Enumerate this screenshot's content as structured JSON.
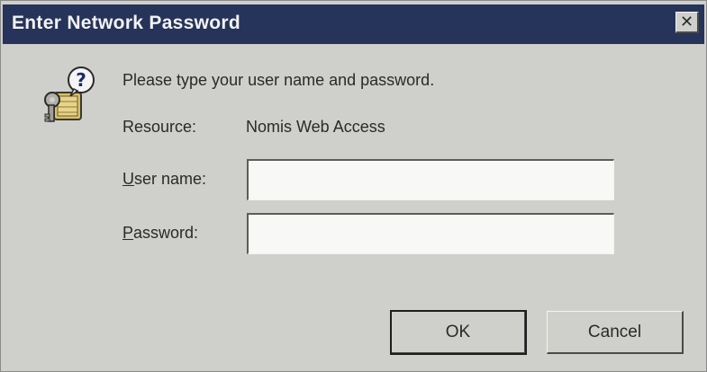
{
  "window": {
    "title": "Enter Network Password",
    "close_glyph": "✕"
  },
  "icon": {
    "name": "keys-icon"
  },
  "prompt": "Please type your user name and password.",
  "resource": {
    "label": "Resource:",
    "value": "Nomis Web Access"
  },
  "user_name": {
    "label_accel": "U",
    "label_rest": "ser name:",
    "value": "",
    "placeholder": ""
  },
  "password": {
    "label_accel": "P",
    "label_rest": "assword:",
    "value": "",
    "placeholder": ""
  },
  "buttons": {
    "ok": "OK",
    "cancel": "Cancel"
  },
  "colors": {
    "titlebar": "#26335a",
    "dialog_bg": "#cfcfcb"
  }
}
